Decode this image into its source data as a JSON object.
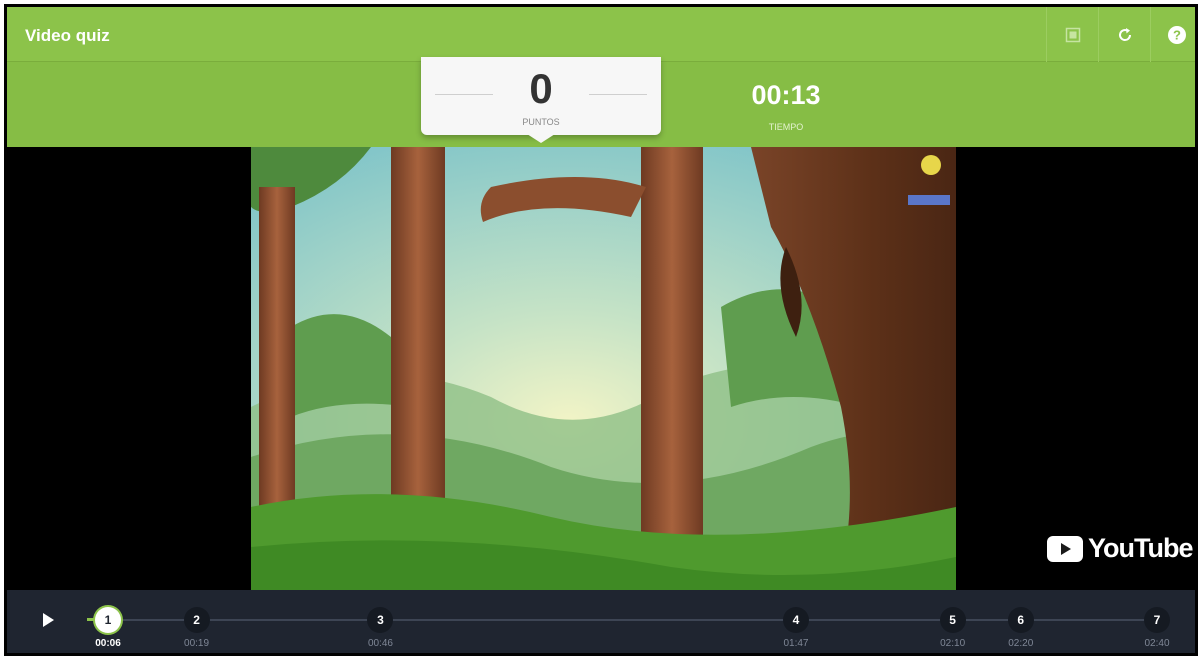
{
  "app": {
    "title": "Video quiz"
  },
  "toolbar": {
    "buttons": [
      {
        "icon": "fullscreen-icon"
      },
      {
        "icon": "restart-icon"
      },
      {
        "icon": "help-icon"
      }
    ]
  },
  "score": {
    "value": "0",
    "label": "PUNTOS"
  },
  "timer": {
    "value": "00:13",
    "label": "TIEMPO"
  },
  "video": {
    "provider_label": "YouTube"
  },
  "timeline": {
    "progress_fraction": 0.03,
    "cues": [
      {
        "number": "1",
        "time": "00:06",
        "active": true
      },
      {
        "number": "2",
        "time": "00:19",
        "active": false
      },
      {
        "number": "3",
        "time": "00:46",
        "active": false
      },
      {
        "number": "4",
        "time": "01:47",
        "active": false
      },
      {
        "number": "5",
        "time": "02:10",
        "active": false
      },
      {
        "number": "6",
        "time": "02:20",
        "active": false
      },
      {
        "number": "7",
        "time": "02:40",
        "active": false
      }
    ]
  },
  "colors": {
    "accent": "#8cc34a",
    "header": "#86bd45",
    "controls": "#1f2530"
  }
}
